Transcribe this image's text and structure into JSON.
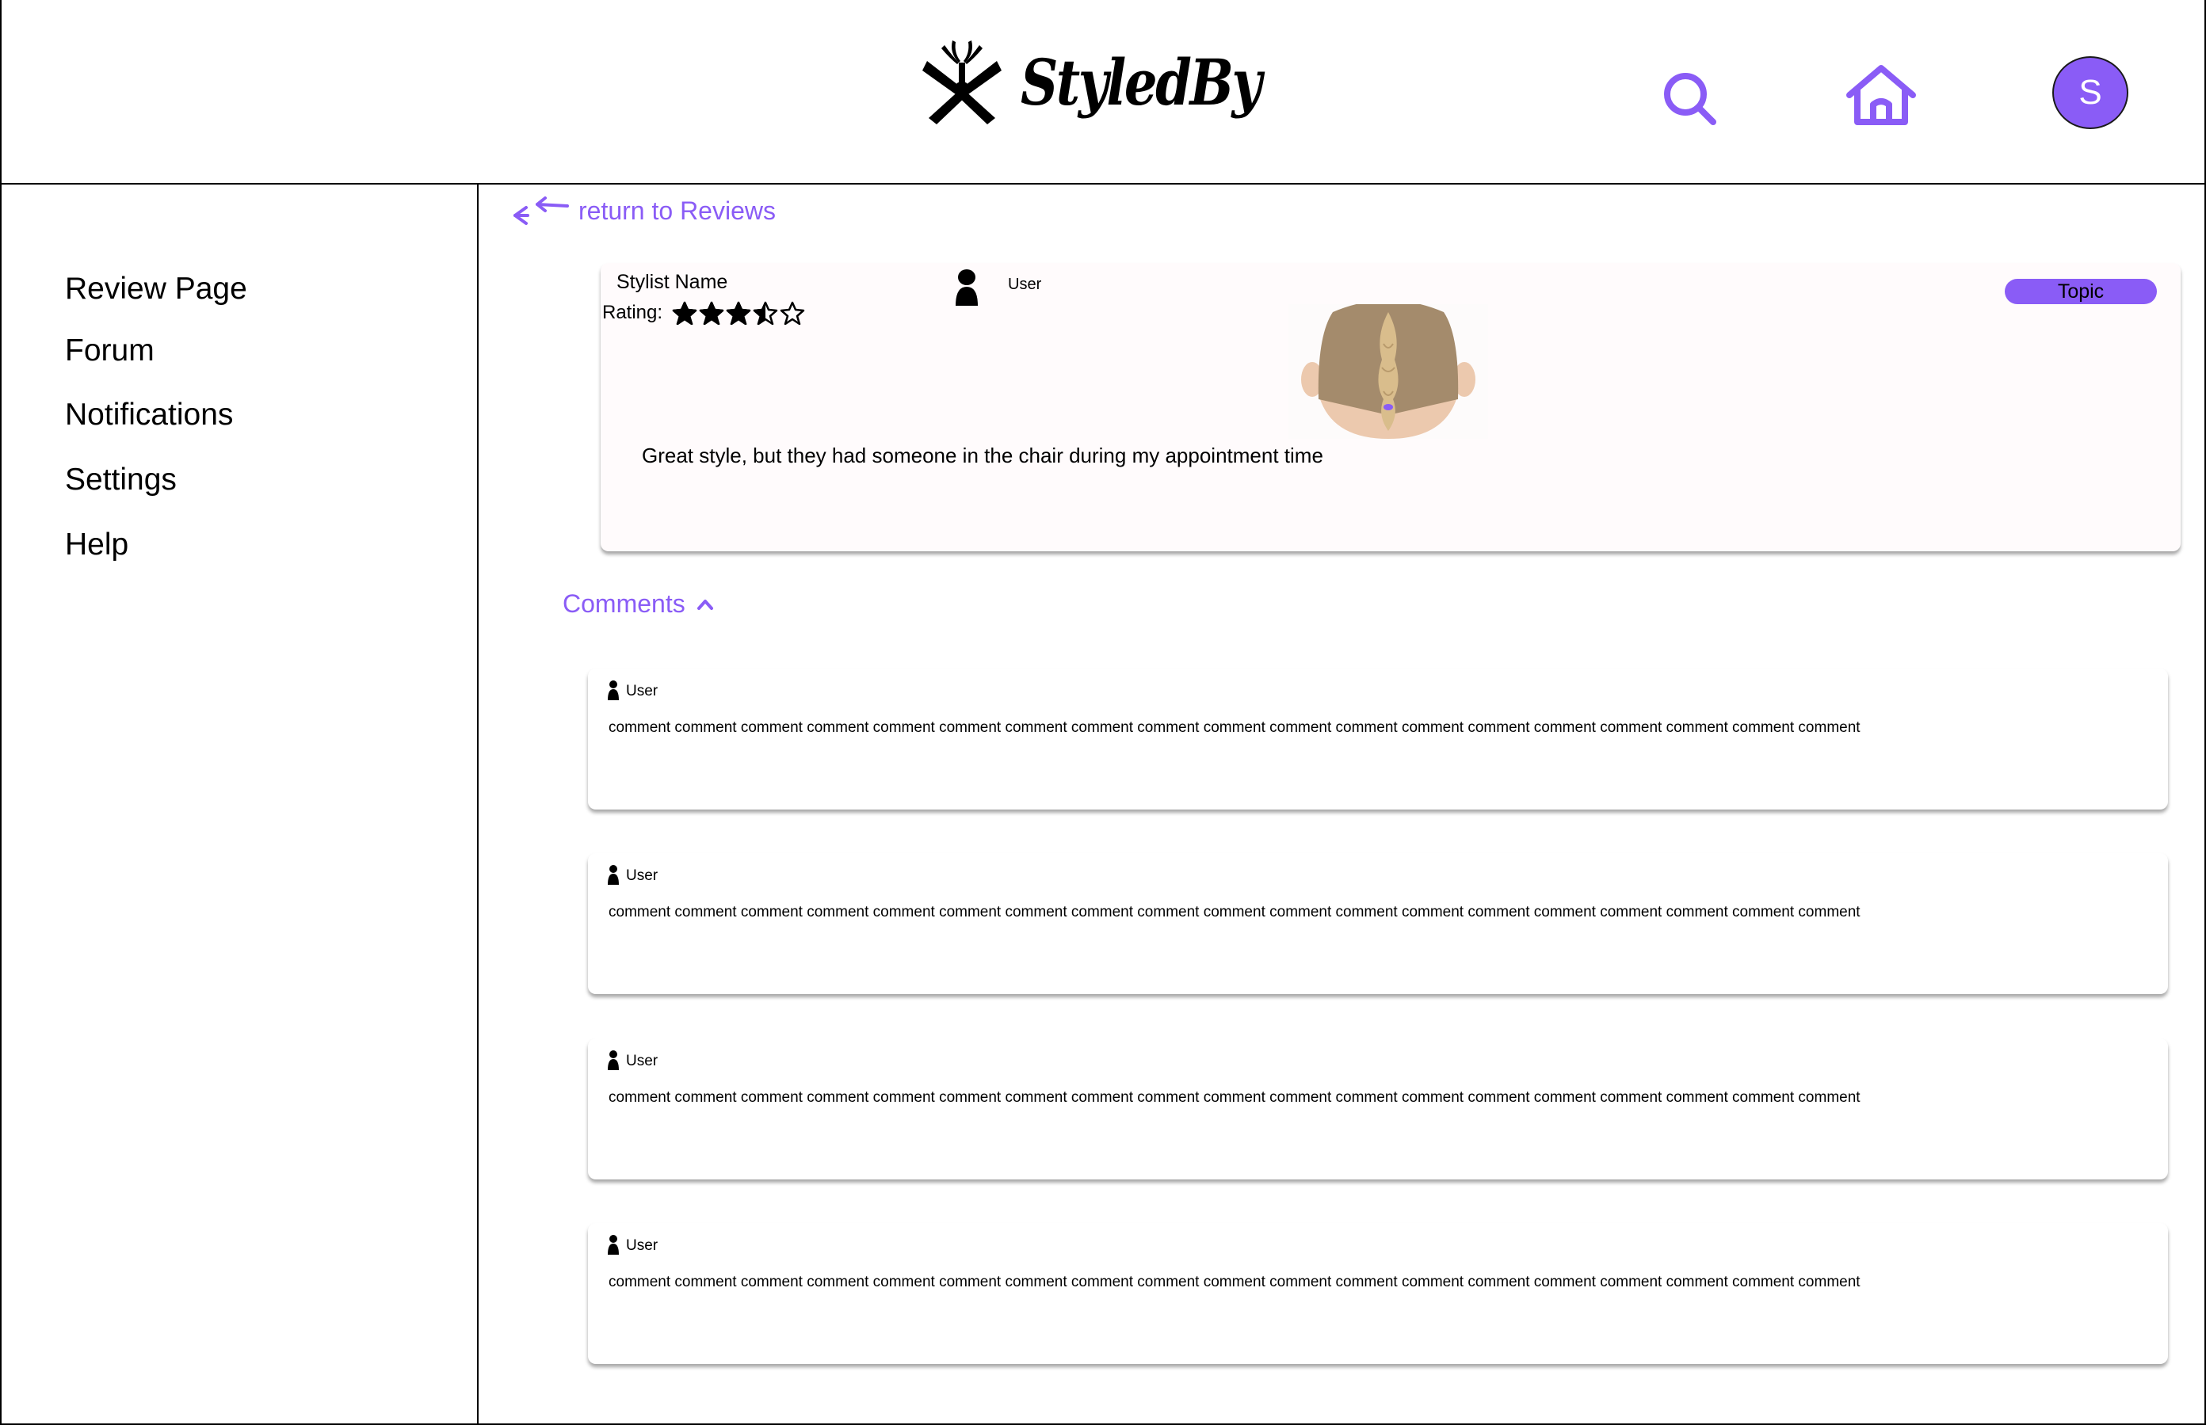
{
  "app": {
    "logo_text": "StyledBy",
    "accent_color": "#8a5cf6"
  },
  "header": {
    "search_icon": "search-icon",
    "home_icon": "home-icon",
    "avatar_initial": "S"
  },
  "sidebar": {
    "items": [
      {
        "label": "Review Page"
      },
      {
        "label": "Forum"
      },
      {
        "label": "Notifications"
      },
      {
        "label": "Settings"
      },
      {
        "label": "Help"
      }
    ]
  },
  "main": {
    "return_link": "return to Reviews",
    "review": {
      "stylist_name": "Stylist Name",
      "rating_label": "Rating:",
      "rating": 3.5,
      "rating_max": 5,
      "user": "User",
      "topic": "Topic",
      "text": "Great style, but they had someone in the chair during my appointment time"
    },
    "comments_label": "Comments",
    "comments": [
      {
        "user": "User",
        "text": "comment comment comment comment comment comment comment comment comment comment comment comment comment comment comment comment comment comment comment"
      },
      {
        "user": "User",
        "text": "comment comment comment comment comment comment comment comment comment comment comment comment comment comment comment comment comment comment comment"
      },
      {
        "user": "User",
        "text": "comment comment comment comment comment comment comment comment comment comment comment comment comment comment comment comment comment comment comment"
      },
      {
        "user": "User",
        "text": "comment comment comment comment comment comment comment comment comment comment comment comment comment comment comment comment comment comment comment"
      }
    ]
  }
}
